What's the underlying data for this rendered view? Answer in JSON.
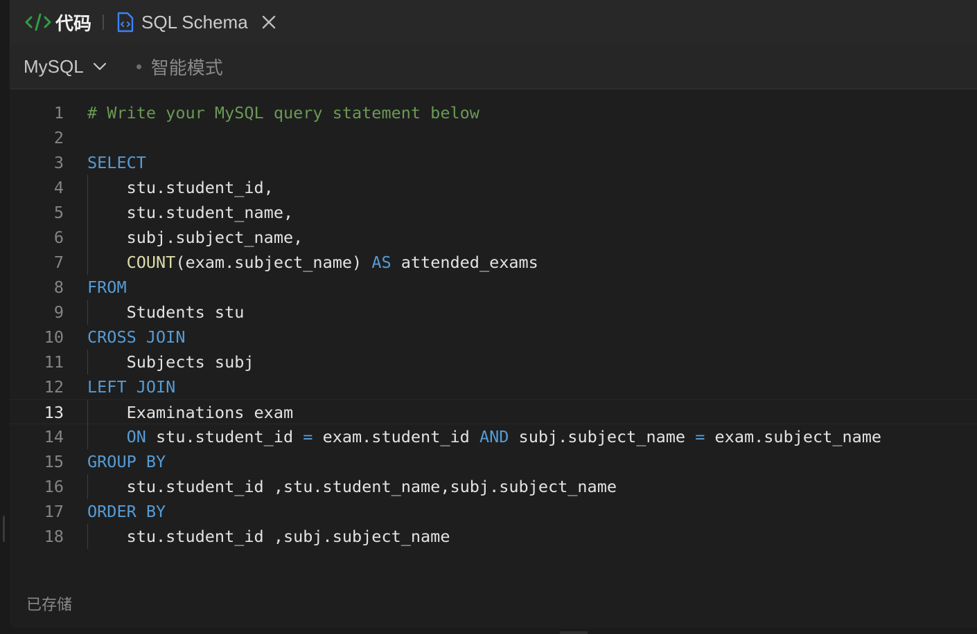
{
  "tabs": {
    "code_label": "代码",
    "schema_label": "SQL Schema"
  },
  "toolbar": {
    "language": "MySQL",
    "smart_mode": "智能模式"
  },
  "editor": {
    "active_line": 13,
    "lines": [
      {
        "n": "1",
        "indent": false,
        "tokens": [
          {
            "t": "comment",
            "v": "# Write your MySQL query statement below"
          }
        ]
      },
      {
        "n": "2",
        "indent": false,
        "tokens": []
      },
      {
        "n": "3",
        "indent": false,
        "tokens": [
          {
            "t": "kw",
            "v": "SELECT"
          }
        ]
      },
      {
        "n": "4",
        "indent": true,
        "tokens": [
          {
            "t": "plain",
            "v": "    stu.student_id,"
          }
        ]
      },
      {
        "n": "5",
        "indent": true,
        "tokens": [
          {
            "t": "plain",
            "v": "    stu.student_name,"
          }
        ]
      },
      {
        "n": "6",
        "indent": true,
        "tokens": [
          {
            "t": "plain",
            "v": "    subj.subject_name,"
          }
        ]
      },
      {
        "n": "7",
        "indent": true,
        "tokens": [
          {
            "t": "plain",
            "v": "    "
          },
          {
            "t": "fn",
            "v": "COUNT"
          },
          {
            "t": "plain",
            "v": "(exam.subject_name) "
          },
          {
            "t": "kw",
            "v": "AS"
          },
          {
            "t": "plain",
            "v": " attended_exams"
          }
        ]
      },
      {
        "n": "8",
        "indent": false,
        "tokens": [
          {
            "t": "kw",
            "v": "FROM"
          }
        ]
      },
      {
        "n": "9",
        "indent": true,
        "tokens": [
          {
            "t": "plain",
            "v": "    Students stu"
          }
        ]
      },
      {
        "n": "10",
        "indent": false,
        "tokens": [
          {
            "t": "kw",
            "v": "CROSS JOIN"
          }
        ]
      },
      {
        "n": "11",
        "indent": true,
        "tokens": [
          {
            "t": "plain",
            "v": "    Subjects subj"
          }
        ]
      },
      {
        "n": "12",
        "indent": false,
        "tokens": [
          {
            "t": "kw",
            "v": "LEFT JOIN"
          }
        ]
      },
      {
        "n": "13",
        "indent": true,
        "tokens": [
          {
            "t": "plain",
            "v": "    Examinations exam"
          }
        ]
      },
      {
        "n": "14",
        "indent": true,
        "tokens": [
          {
            "t": "plain",
            "v": "    "
          },
          {
            "t": "kw",
            "v": "ON"
          },
          {
            "t": "plain",
            "v": " stu.student_id "
          },
          {
            "t": "op",
            "v": "="
          },
          {
            "t": "plain",
            "v": " exam.student_id "
          },
          {
            "t": "kw",
            "v": "AND"
          },
          {
            "t": "plain",
            "v": " subj.subject_name "
          },
          {
            "t": "op",
            "v": "="
          },
          {
            "t": "plain",
            "v": " exam.subject_name"
          }
        ]
      },
      {
        "n": "15",
        "indent": false,
        "tokens": [
          {
            "t": "kw",
            "v": "GROUP BY"
          }
        ]
      },
      {
        "n": "16",
        "indent": true,
        "tokens": [
          {
            "t": "plain",
            "v": "    stu.student_id ,stu.student_name,subj.subject_name"
          }
        ]
      },
      {
        "n": "17",
        "indent": false,
        "tokens": [
          {
            "t": "kw",
            "v": "ORDER BY"
          }
        ]
      },
      {
        "n": "18",
        "indent": true,
        "tokens": [
          {
            "t": "plain",
            "v": "    stu.student_id ,subj.subject_name"
          }
        ]
      }
    ]
  },
  "footer": {
    "status": "已存储"
  },
  "colors": {
    "code_icon": "#2ea043",
    "file_icon": "#3b82f6",
    "keyword": "#569cd6",
    "function": "#dcdcaa",
    "comment": "#6a9955"
  }
}
